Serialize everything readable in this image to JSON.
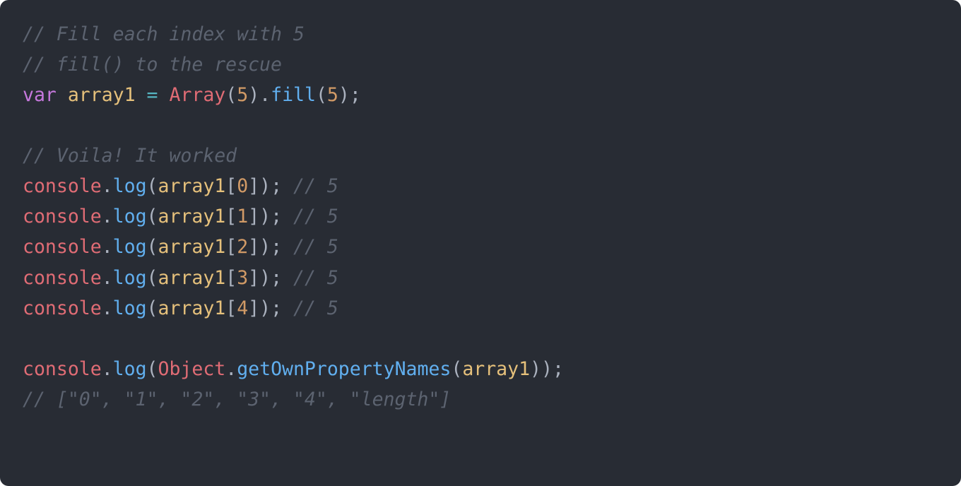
{
  "code": {
    "lines": [
      {
        "type": "comment",
        "tokens": [
          {
            "cls": "c-comment",
            "t": "// Fill each index with 5"
          }
        ]
      },
      {
        "type": "comment",
        "tokens": [
          {
            "cls": "c-comment",
            "t": "// fill() to the rescue"
          }
        ]
      },
      {
        "type": "code",
        "tokens": [
          {
            "cls": "c-keyword",
            "t": "var"
          },
          {
            "cls": "c-plain",
            "t": " "
          },
          {
            "cls": "c-var",
            "t": "array1"
          },
          {
            "cls": "c-plain",
            "t": " "
          },
          {
            "cls": "c-op",
            "t": "="
          },
          {
            "cls": "c-plain",
            "t": " "
          },
          {
            "cls": "c-class",
            "t": "Array"
          },
          {
            "cls": "c-punct",
            "t": "("
          },
          {
            "cls": "c-number",
            "t": "5"
          },
          {
            "cls": "c-punct",
            "t": ")."
          },
          {
            "cls": "c-func",
            "t": "fill"
          },
          {
            "cls": "c-punct",
            "t": "("
          },
          {
            "cls": "c-number",
            "t": "5"
          },
          {
            "cls": "c-punct",
            "t": ");"
          }
        ]
      },
      {
        "type": "blank",
        "tokens": []
      },
      {
        "type": "comment",
        "tokens": [
          {
            "cls": "c-comment",
            "t": "// Voila! It worked"
          }
        ]
      },
      {
        "type": "code",
        "tokens": [
          {
            "cls": "c-class",
            "t": "console"
          },
          {
            "cls": "c-punct",
            "t": "."
          },
          {
            "cls": "c-func",
            "t": "log"
          },
          {
            "cls": "c-punct",
            "t": "("
          },
          {
            "cls": "c-var",
            "t": "array1"
          },
          {
            "cls": "c-punct",
            "t": "["
          },
          {
            "cls": "c-number",
            "t": "0"
          },
          {
            "cls": "c-punct",
            "t": "]); "
          },
          {
            "cls": "c-comment",
            "t": "// 5"
          }
        ]
      },
      {
        "type": "code",
        "tokens": [
          {
            "cls": "c-class",
            "t": "console"
          },
          {
            "cls": "c-punct",
            "t": "."
          },
          {
            "cls": "c-func",
            "t": "log"
          },
          {
            "cls": "c-punct",
            "t": "("
          },
          {
            "cls": "c-var",
            "t": "array1"
          },
          {
            "cls": "c-punct",
            "t": "["
          },
          {
            "cls": "c-number",
            "t": "1"
          },
          {
            "cls": "c-punct",
            "t": "]); "
          },
          {
            "cls": "c-comment",
            "t": "// 5"
          }
        ]
      },
      {
        "type": "code",
        "tokens": [
          {
            "cls": "c-class",
            "t": "console"
          },
          {
            "cls": "c-punct",
            "t": "."
          },
          {
            "cls": "c-func",
            "t": "log"
          },
          {
            "cls": "c-punct",
            "t": "("
          },
          {
            "cls": "c-var",
            "t": "array1"
          },
          {
            "cls": "c-punct",
            "t": "["
          },
          {
            "cls": "c-number",
            "t": "2"
          },
          {
            "cls": "c-punct",
            "t": "]); "
          },
          {
            "cls": "c-comment",
            "t": "// 5"
          }
        ]
      },
      {
        "type": "code",
        "tokens": [
          {
            "cls": "c-class",
            "t": "console"
          },
          {
            "cls": "c-punct",
            "t": "."
          },
          {
            "cls": "c-func",
            "t": "log"
          },
          {
            "cls": "c-punct",
            "t": "("
          },
          {
            "cls": "c-var",
            "t": "array1"
          },
          {
            "cls": "c-punct",
            "t": "["
          },
          {
            "cls": "c-number",
            "t": "3"
          },
          {
            "cls": "c-punct",
            "t": "]); "
          },
          {
            "cls": "c-comment",
            "t": "// 5"
          }
        ]
      },
      {
        "type": "code",
        "tokens": [
          {
            "cls": "c-class",
            "t": "console"
          },
          {
            "cls": "c-punct",
            "t": "."
          },
          {
            "cls": "c-func",
            "t": "log"
          },
          {
            "cls": "c-punct",
            "t": "("
          },
          {
            "cls": "c-var",
            "t": "array1"
          },
          {
            "cls": "c-punct",
            "t": "["
          },
          {
            "cls": "c-number",
            "t": "4"
          },
          {
            "cls": "c-punct",
            "t": "]); "
          },
          {
            "cls": "c-comment",
            "t": "// 5"
          }
        ]
      },
      {
        "type": "blank",
        "tokens": []
      },
      {
        "type": "code",
        "tokens": [
          {
            "cls": "c-class",
            "t": "console"
          },
          {
            "cls": "c-punct",
            "t": "."
          },
          {
            "cls": "c-func",
            "t": "log"
          },
          {
            "cls": "c-punct",
            "t": "("
          },
          {
            "cls": "c-class",
            "t": "Object"
          },
          {
            "cls": "c-punct",
            "t": "."
          },
          {
            "cls": "c-func",
            "t": "getOwnPropertyNames"
          },
          {
            "cls": "c-punct",
            "t": "("
          },
          {
            "cls": "c-var",
            "t": "array1"
          },
          {
            "cls": "c-punct",
            "t": "));"
          }
        ]
      },
      {
        "type": "comment",
        "tokens": [
          {
            "cls": "c-comment",
            "t": "// [\"0\", \"1\", \"2\", \"3\", \"4\", \"length\"]"
          }
        ]
      }
    ]
  }
}
